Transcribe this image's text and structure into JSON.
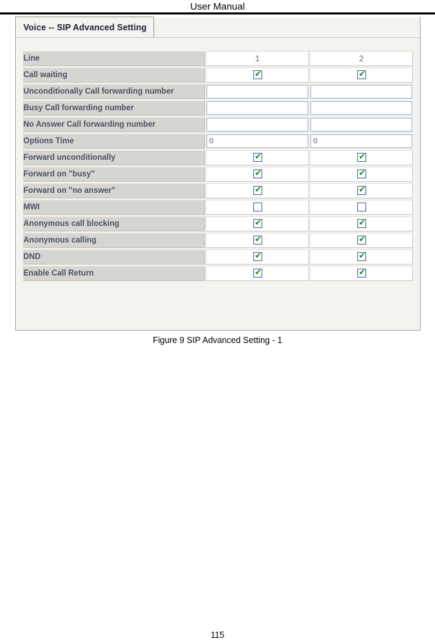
{
  "document": {
    "header_title": "User Manual",
    "figure_caption": "Figure 9 SIP Advanced Setting - 1",
    "page_number": "115"
  },
  "panel": {
    "tab_label": "Voice -- SIP Advanced Setting"
  },
  "table": {
    "header_row": {
      "label": "Line",
      "columns": [
        "1",
        "2"
      ]
    },
    "rows": [
      {
        "label": "Call waiting",
        "type": "checkbox",
        "values": [
          true,
          true
        ]
      },
      {
        "label": "Unconditionally Call forwarding number",
        "type": "text",
        "values": [
          "",
          ""
        ],
        "placeholders": [
          "",
          ""
        ]
      },
      {
        "label": "Busy Call forwarding number",
        "type": "text",
        "values": [
          "",
          ""
        ],
        "placeholders": [
          "",
          ""
        ]
      },
      {
        "label": "No Answer Call forwarding number",
        "type": "text",
        "values": [
          "",
          ""
        ],
        "placeholders": [
          "",
          ""
        ]
      },
      {
        "label": "Options Time",
        "type": "text",
        "values": [
          "0",
          "0"
        ],
        "placeholders": [
          "",
          ""
        ]
      },
      {
        "label": "Forward unconditionally",
        "type": "checkbox",
        "values": [
          true,
          true
        ]
      },
      {
        "label": "Forward on \"busy\"",
        "type": "checkbox",
        "values": [
          true,
          true
        ]
      },
      {
        "label": "Forward on \"no answer\"",
        "type": "checkbox",
        "values": [
          true,
          true
        ]
      },
      {
        "label": "MWI",
        "type": "checkbox",
        "values": [
          false,
          false
        ]
      },
      {
        "label": "Anonymous call blocking",
        "type": "checkbox",
        "values": [
          true,
          true
        ]
      },
      {
        "label": "Anonymous calling",
        "type": "checkbox",
        "values": [
          true,
          true
        ]
      },
      {
        "label": "DND",
        "type": "checkbox",
        "values": [
          true,
          true
        ]
      },
      {
        "label": "Enable Call Return",
        "type": "checkbox",
        "values": [
          true,
          true
        ]
      }
    ]
  },
  "icons": {
    "check_glyph": "✔"
  },
  "colors": {
    "label_cell_bg": "#d6d5d1",
    "label_text": "#4b5363",
    "checkbox_border": "#41689b",
    "check_mark": "#178a17",
    "input_border": "#9fb3cc",
    "panel_bg": "#f4f3ef"
  }
}
